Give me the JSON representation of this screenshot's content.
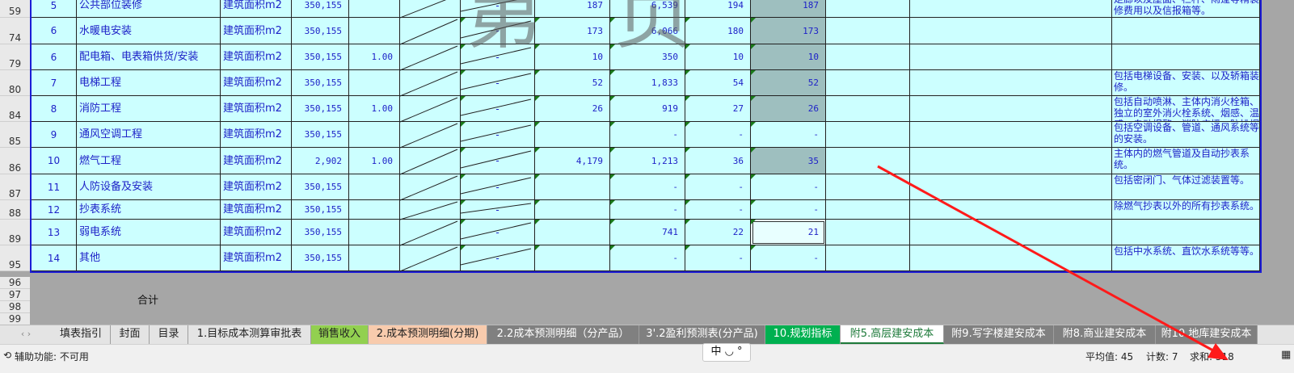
{
  "rows": [
    {
      "rowno": "59",
      "seq": "5",
      "name": "公共部位装修",
      "unit": "建筑面积m2",
      "qty": "350,155",
      "ratio": "",
      "dash": "-",
      "c1": "187",
      "c2": "6,539",
      "c3": "194",
      "c4": "187",
      "note": "走廊以及屋面、栏杆、雨蓬等精装修费用以及信报箱等。"
    },
    {
      "rowno": "74",
      "seq": "6",
      "name": "水暖电安装",
      "unit": "建筑面积m2",
      "qty": "350,155",
      "ratio": "",
      "dash": "-",
      "c1": "173",
      "c2": "6,066",
      "c3": "180",
      "c4": "173",
      "note": ""
    },
    {
      "rowno": "79",
      "seq": "6",
      "name": "配电箱、电表箱供货/安装",
      "unit": "建筑面积m2",
      "qty": "350,155",
      "ratio": "1.00",
      "dash": "-",
      "c1": "10",
      "c2": "350",
      "c3": "10",
      "c4": "10",
      "note": ""
    },
    {
      "rowno": "80",
      "seq": "7",
      "name": "电梯工程",
      "unit": "建筑面积m2",
      "qty": "350,155",
      "ratio": "",
      "dash": "-",
      "c1": "52",
      "c2": "1,833",
      "c3": "54",
      "c4": "52",
      "note": "包括电梯设备、安装、以及轿箱装修。"
    },
    {
      "rowno": "84",
      "seq": "8",
      "name": "消防工程",
      "unit": "建筑面积m2",
      "qty": "350,155",
      "ratio": "1.00",
      "dash": "-",
      "c1": "26",
      "c2": "919",
      "c3": "27",
      "c4": "26",
      "note": "包括自动喷淋、主体内消火栓箱、独立的室外消火栓系统、烟感、温感、自动报警、消防广播、防排烟"
    },
    {
      "rowno": "85",
      "seq": "9",
      "name": "通风空调工程",
      "unit": "建筑面积m2",
      "qty": "350,155",
      "ratio": "",
      "dash": "-",
      "c1": "",
      "c2": "-",
      "c3": "-",
      "c4": "-",
      "note": "包括空调设备、管道、通风系统等的安装。"
    },
    {
      "rowno": "86",
      "seq": "10",
      "name": "燃气工程",
      "unit": "建筑面积m2",
      "qty": "2,902",
      "ratio": "1.00",
      "dash": "-",
      "c1": "4,179",
      "c2": "1,213",
      "c3": "36",
      "c4": "35",
      "note": "主体内的燃气管道及自动抄表系统。"
    },
    {
      "rowno": "87",
      "seq": "11",
      "name": "人防设备及安装",
      "unit": "建筑面积m2",
      "qty": "350,155",
      "ratio": "",
      "dash": "-",
      "c1": "",
      "c2": "-",
      "c3": "-",
      "c4": "-",
      "note": "包括密闭门、气体过滤装置等。"
    },
    {
      "rowno": "88",
      "seq": "12",
      "name": "抄表系统",
      "unit": "建筑面积m2",
      "qty": "350,155",
      "ratio": "",
      "dash": "-",
      "c1": "",
      "c2": "-",
      "c3": "-",
      "c4": "-",
      "note": "除燃气抄表以外的所有抄表系统。"
    },
    {
      "rowno": "89",
      "seq": "13",
      "name": "弱电系统",
      "unit": "建筑面积m2",
      "qty": "350,155",
      "ratio": "",
      "dash": "-",
      "c1": "",
      "c2": "741",
      "c3": "22",
      "c4": "21",
      "note": ""
    },
    {
      "rowno": "95",
      "seq": "14",
      "name": "其他",
      "unit": "建筑面积m2",
      "qty": "350,155",
      "ratio": "",
      "dash": "-",
      "c1": "",
      "c2": "-",
      "c3": "-",
      "c4": "-",
      "note": "包括中水系统、直饮水系统等等。"
    }
  ],
  "extra_rows": [
    "96",
    "97",
    "98",
    "99"
  ],
  "total_label": "合计",
  "watermark": {
    "left": "第",
    "right": "页"
  },
  "tabs": [
    {
      "label": "填表指引",
      "color": "#e4e4e4",
      "active": false
    },
    {
      "label": "封面",
      "color": "#e4e4e4",
      "active": false
    },
    {
      "label": "目录",
      "color": "#e4e4e4",
      "active": false
    },
    {
      "label": "1.目标成本测算审批表",
      "color": "#e4e4e4",
      "active": false
    },
    {
      "label": "销售收入",
      "color": "#92d050",
      "active": false
    },
    {
      "label": "2.成本预测明细(分期)",
      "color": "#f8cbad",
      "active": false
    },
    {
      "label": "2.2成本预测明细（分产品）",
      "color": "#808080",
      "active": false
    },
    {
      "label": "3'.2盈利预测表(分产品)",
      "color": "#808080",
      "active": false
    },
    {
      "label": "10.规划指标",
      "color": "#00b050",
      "active": false
    },
    {
      "label": "附5.高层建安成本",
      "color": "#ffffff",
      "active": true
    },
    {
      "label": "附9.写字楼建安成本",
      "color": "#808080",
      "active": false
    },
    {
      "label": "附8.商业建安成本",
      "color": "#808080",
      "active": false
    },
    {
      "label": "附10.地库建安成本",
      "color": "#808080",
      "active": false
    }
  ],
  "status": {
    "accessibility": "辅助功能: 不可用",
    "average": "平均值: 45",
    "count": "计数: 7",
    "sum": "求和: 318",
    "ime": "中 ◡ °"
  }
}
